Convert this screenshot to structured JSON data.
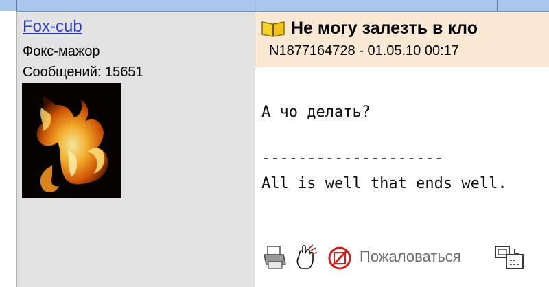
{
  "author": {
    "name": "Fox-cub",
    "rank": "Фокс-мажор",
    "posts_count": "Сообщений: 15651"
  },
  "post": {
    "title": "Не могу залезть в кло",
    "meta": "N1877164728 - 01.05.10 00:17",
    "lines": [
      "А чо делать?",
      "",
      "--------------------",
      "All is well that ends well."
    ]
  },
  "actions": {
    "report_label": "Пожаловаться"
  }
}
